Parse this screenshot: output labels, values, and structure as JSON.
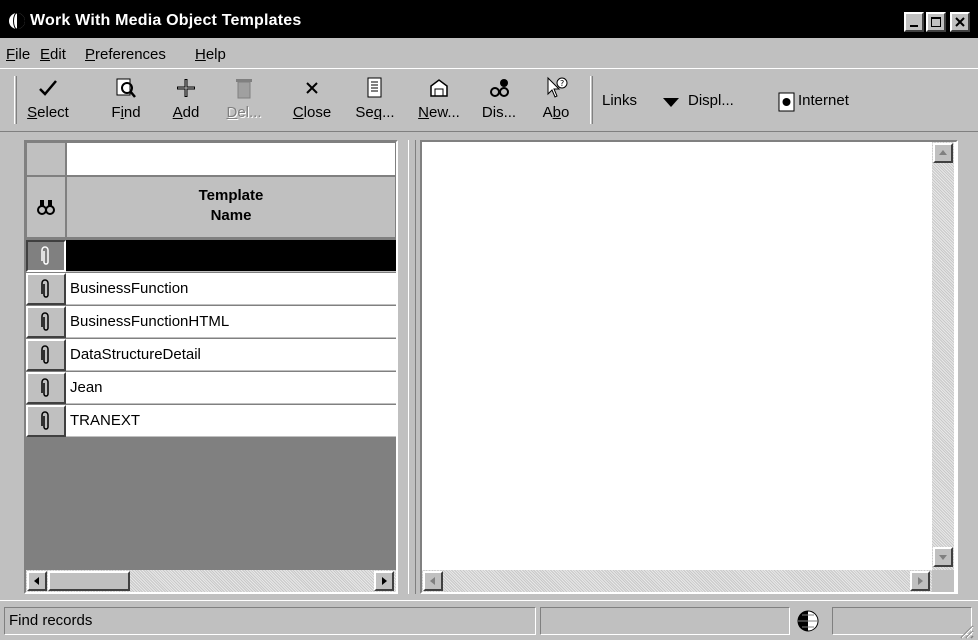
{
  "window": {
    "title": "Work With Media Object Templates"
  },
  "menu": [
    {
      "label": "File",
      "u": "F",
      "rest": "ile"
    },
    {
      "label": "Edit",
      "u": "E",
      "rest": "dit"
    },
    {
      "label": "Preferences",
      "u": "P",
      "rest": "references"
    },
    {
      "label": "Help",
      "u": "H",
      "rest": "elp"
    }
  ],
  "toolbar": {
    "select": {
      "u": "S",
      "rest": "elect"
    },
    "find": {
      "pre": "F",
      "u": "i",
      "rest": "nd"
    },
    "add": {
      "u": "A",
      "rest": "dd"
    },
    "delete": {
      "u": "D",
      "rest": "el..."
    },
    "close": {
      "u": "C",
      "rest": "lose"
    },
    "seq": {
      "pre": "Se",
      "u": "q",
      "rest": "..."
    },
    "new": {
      "u": "N",
      "rest": "ew..."
    },
    "dis": {
      "label": "Dis..."
    },
    "abo": {
      "pre": "A",
      "u": "b",
      "rest": "o"
    },
    "links": "Links",
    "display": "Displ...",
    "internet": "Internet"
  },
  "grid": {
    "qbe_value": "",
    "column_header_line1": "Template",
    "column_header_line2": "Name",
    "rows": [
      {
        "name": "",
        "selected": true
      },
      {
        "name": "BusinessFunction"
      },
      {
        "name": "BusinessFunctionHTML"
      },
      {
        "name": "DataStructureDetail"
      },
      {
        "name": "Jean"
      },
      {
        "name": "TRANEXT"
      }
    ]
  },
  "status": {
    "text": "Find records"
  },
  "icons": [
    "globe-icon",
    "minimize-icon",
    "maximize-icon",
    "close-icon",
    "checkmark-icon",
    "find-icon",
    "add-icon",
    "trash-icon",
    "x-icon",
    "sequence-icon",
    "new-icon",
    "display-icon",
    "about-icon",
    "dropdown-arrow-icon",
    "internet-icon",
    "binoculars-icon",
    "paperclip-icon",
    "network-globe-icon",
    "size-grip-icon"
  ]
}
